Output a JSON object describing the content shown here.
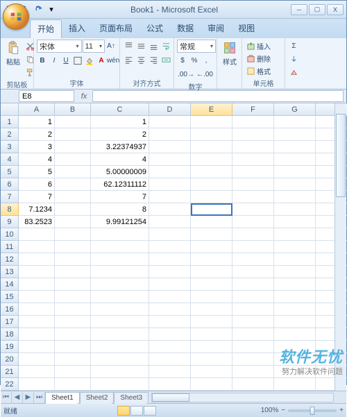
{
  "window": {
    "title": "Book1 - Microsoft Excel",
    "controls": {
      "min": "─",
      "max": "▢",
      "close": "X"
    }
  },
  "qat": {
    "save": "save",
    "undo": "undo",
    "redo": "redo",
    "more": "▾"
  },
  "tabs": [
    "开始",
    "插入",
    "页面布局",
    "公式",
    "数据",
    "审阅",
    "视图"
  ],
  "active_tab_index": 0,
  "ribbon": {
    "clipboard": {
      "label": "剪贴板",
      "paste": "粘贴"
    },
    "font": {
      "label": "字体",
      "name": "宋体",
      "size": "11"
    },
    "align": {
      "label": "对齐方式"
    },
    "number": {
      "label": "数字",
      "format": "常规"
    },
    "styles": {
      "label": "样式"
    },
    "cells": {
      "label": "单元格",
      "insert": "插入",
      "delete": "删除",
      "format": "格式"
    },
    "editing_sigma": "Σ"
  },
  "namebox": "E8",
  "columns": [
    "A",
    "B",
    "C",
    "D",
    "E",
    "F",
    "G"
  ],
  "rows": 22,
  "cells": {
    "A1": "1",
    "A2": "2",
    "A3": "3",
    "A4": "4",
    "A5": "5",
    "A6": "6",
    "A7": "7",
    "A8": "7.1234",
    "A9": "83.2523",
    "C1": "1",
    "C2": "2",
    "C3": "3.22374937",
    "C4": "4",
    "C5": "5.00000009",
    "C6": "62.12311112",
    "C7": "7",
    "C8": "8",
    "C9": "9.99121254"
  },
  "selected_cell": "E8",
  "sheets": [
    "Sheet1",
    "Sheet2",
    "Sheet3"
  ],
  "active_sheet_index": 0,
  "status": {
    "ready": "就绪",
    "zoom": "100%",
    "minus": "−",
    "plus": "+"
  },
  "watermark": {
    "line1": "软件无忧",
    "line2": "努力解决软件问题"
  }
}
